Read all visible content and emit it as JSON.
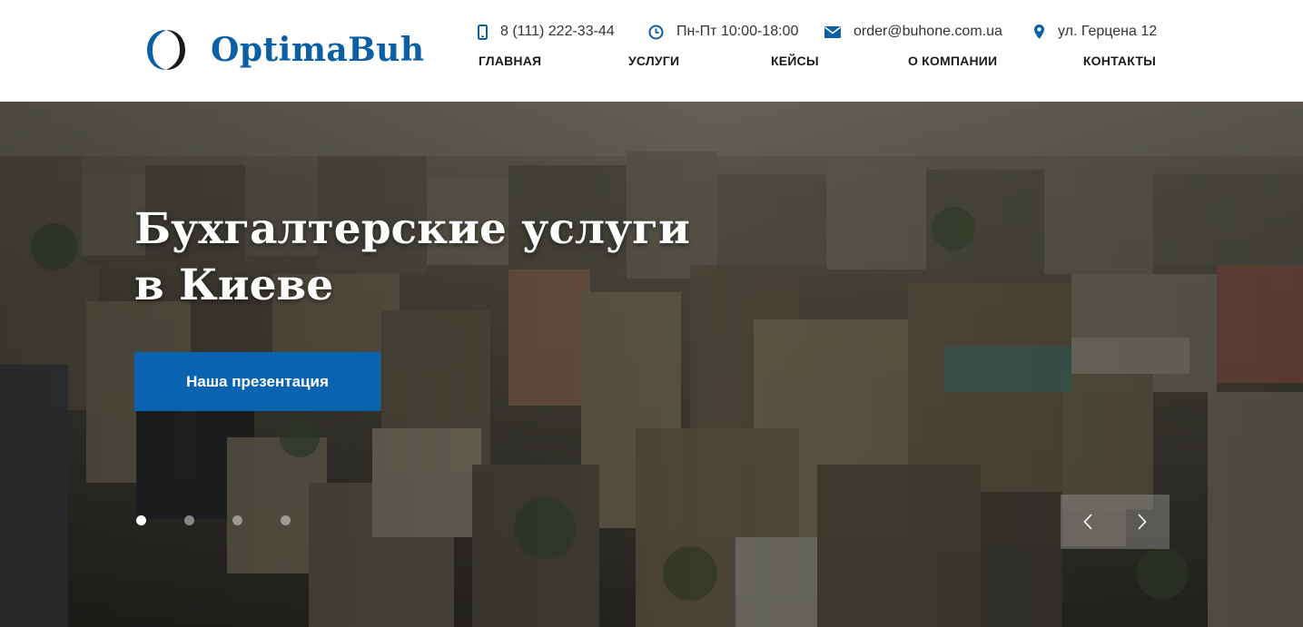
{
  "brand": {
    "name": "OptimaBuh",
    "color": "#0b5fa5"
  },
  "contacts": {
    "phone": "8 (111) 222-33-44",
    "hours": "Пн-Пт 10:00-18:00",
    "email": "order@buhone.com.ua",
    "address": "ул. Герцена 12",
    "icons": [
      "phone-icon",
      "clock-icon",
      "mail-icon",
      "location-pin-icon"
    ]
  },
  "nav": {
    "items": [
      {
        "label": "Главная"
      },
      {
        "label": "Услуги"
      },
      {
        "label": "Кейсы"
      },
      {
        "label": "О компании"
      },
      {
        "label": "Контакты"
      }
    ]
  },
  "hero": {
    "title_line1": "Бухгалтерские услуги",
    "title_line2": "в Киеве",
    "cta_label": "Наша презентация",
    "cta_color": "#0a63b0",
    "slides_count": 4,
    "active_slide": 1
  },
  "slider_controls": {
    "prev_icon": "chevron-left-icon",
    "next_icon": "chevron-right-icon"
  }
}
